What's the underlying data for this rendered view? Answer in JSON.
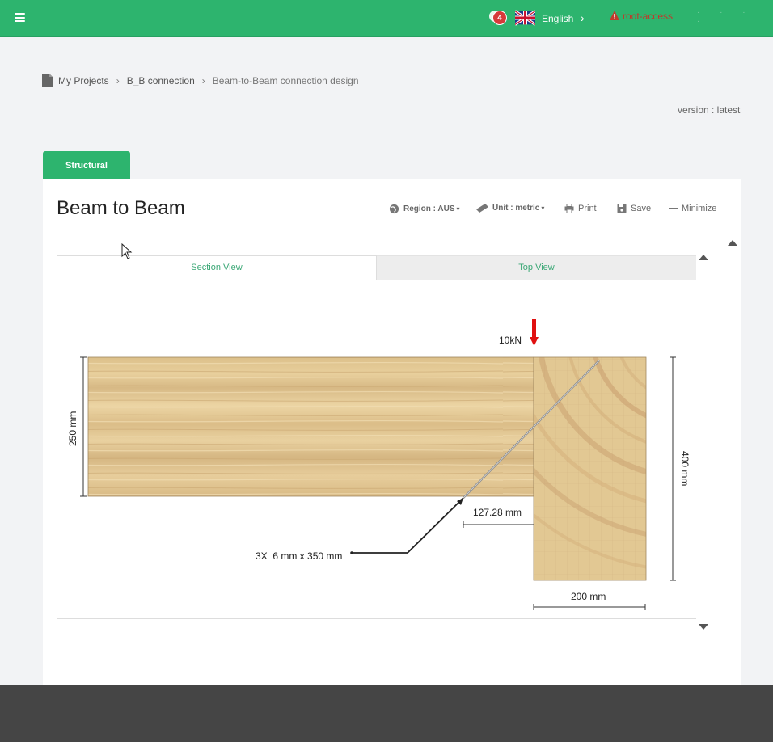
{
  "topbar": {
    "notification_count": "4",
    "language": "English",
    "user": "root-access",
    "menu_icon": "hamburger-icon",
    "bg_color": "#2db46e"
  },
  "breadcrumb": {
    "items": [
      "My Projects",
      "B_B connection",
      "Beam-to-Beam connection design"
    ]
  },
  "version": "version : latest",
  "tab": {
    "label": "Structural"
  },
  "card": {
    "title": "Beam to Beam",
    "toolbar": {
      "region": "Region : AUS",
      "unit": "Unit : metric",
      "print": "Print",
      "save": "Save",
      "minimize": "Minimize"
    },
    "view_tabs": [
      "Section View",
      "Top View"
    ]
  },
  "drawing": {
    "load": "10kN",
    "beam_height": "250 mm",
    "support_height": "400 mm",
    "offset": "127.28 mm",
    "support_width": "200 mm",
    "screws": "3X  6 mm x 350 mm",
    "load_color": "#e01010"
  }
}
